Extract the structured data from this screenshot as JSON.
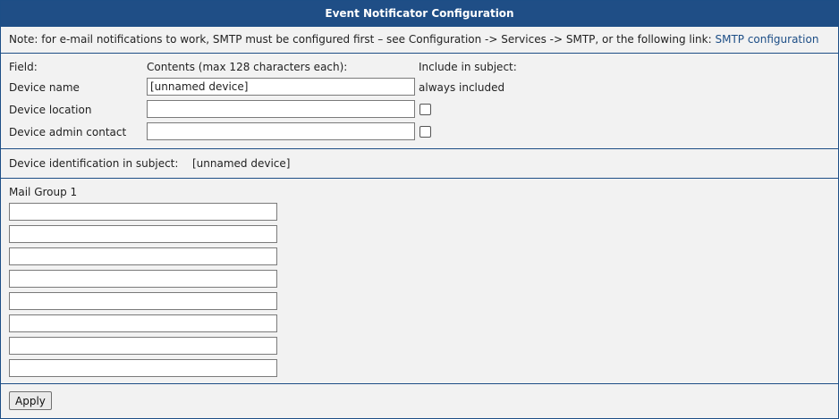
{
  "title": "Event Notificator Configuration",
  "note": {
    "text": "Note: for e-mail notifications to work, SMTP must be configured first – see Configuration -> Services -> SMTP, or the following link: ",
    "link": "SMTP configuration"
  },
  "fields": {
    "header_field": "Field:",
    "header_contents": "Contents (max 128 characters each):",
    "header_include": "Include in subject:",
    "device_name": {
      "label": "Device name",
      "value": "[unnamed device]",
      "include": "always included"
    },
    "device_location": {
      "label": "Device location",
      "value": "",
      "checked": false
    },
    "device_admin": {
      "label": "Device admin contact",
      "value": "",
      "checked": false
    }
  },
  "identification": {
    "label": "Device identification in subject:",
    "value": "[unnamed device]"
  },
  "mail_group": {
    "title": "Mail Group 1",
    "addresses": [
      "",
      "",
      "",
      "",
      "",
      "",
      "",
      ""
    ]
  },
  "apply_label": "Apply",
  "colors": {
    "accent": "#1f4e86",
    "panel_bg": "#f2f2f2",
    "link": "#1d4e86"
  }
}
